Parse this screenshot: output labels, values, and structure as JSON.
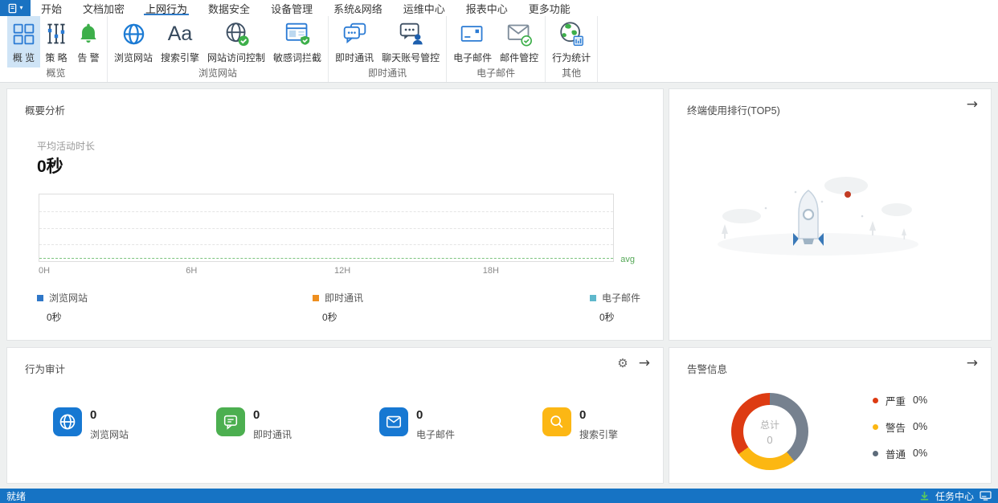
{
  "menu": {
    "items": [
      {
        "label": "开始"
      },
      {
        "label": "文档加密"
      },
      {
        "label": "上网行为",
        "active": true
      },
      {
        "label": "数据安全"
      },
      {
        "label": "设备管理"
      },
      {
        "label": "系统&网络"
      },
      {
        "label": "运维中心"
      },
      {
        "label": "报表中心"
      },
      {
        "label": "更多功能"
      }
    ]
  },
  "icons": {
    "caret_down": "▾",
    "arrow_right": "→",
    "gear": "⚙",
    "aa_glyph": "Aa"
  },
  "ribbon": {
    "groups": [
      {
        "label": "概览",
        "items": [
          {
            "label": "概 览",
            "icon": "overview-grid-icon",
            "selected": true
          },
          {
            "label": "策 略",
            "icon": "policy-sliders-icon"
          },
          {
            "label": "告 警",
            "icon": "alert-bell-icon"
          }
        ]
      },
      {
        "label": "浏览网站",
        "items": [
          {
            "label": "浏览网站",
            "icon": "browse-globe-icon"
          },
          {
            "label": "搜索引擎",
            "icon": "search-engine-aa-icon"
          },
          {
            "label": "网站访问控制",
            "icon": "site-access-control-icon"
          },
          {
            "label": "敏感词拦截",
            "icon": "sensitive-word-block-icon"
          }
        ]
      },
      {
        "label": "即时通讯",
        "items": [
          {
            "label": "即时通讯",
            "icon": "im-chat-icon"
          },
          {
            "label": "聊天账号管控",
            "icon": "chat-account-control-icon"
          }
        ]
      },
      {
        "label": "电子邮件",
        "items": [
          {
            "label": "电子邮件",
            "icon": "email-icon"
          },
          {
            "label": "邮件管控",
            "icon": "mail-control-icon"
          }
        ]
      },
      {
        "label": "其他",
        "items": [
          {
            "label": "行为统计",
            "icon": "behavior-stats-icon"
          }
        ]
      }
    ]
  },
  "summary_card": {
    "title": "概要分析",
    "metric_label": "平均活动时长",
    "metric_value": "0秒",
    "avg_label": "avg",
    "x_ticks": [
      "0H",
      "6H",
      "12H",
      "18H"
    ],
    "legend": [
      {
        "label": "浏览网站",
        "value": "0秒",
        "color": "#2f77c8"
      },
      {
        "label": "即时通讯",
        "value": "0秒",
        "color": "#ee8f20"
      },
      {
        "label": "电子邮件",
        "value": "0秒",
        "color": "#5fb8cc"
      }
    ]
  },
  "top5_card": {
    "title": "终端使用排行(TOP5)"
  },
  "audit_card": {
    "title": "行为审计",
    "stats": [
      {
        "value": "0",
        "label": "浏览网站",
        "icon": "globe-badge-icon",
        "color": "#1778d2"
      },
      {
        "value": "0",
        "label": "即时通讯",
        "icon": "chat-badge-icon",
        "color": "#4caf50"
      },
      {
        "value": "0",
        "label": "电子邮件",
        "icon": "mail-badge-icon",
        "color": "#1778d2"
      },
      {
        "value": "0",
        "label": "搜索引擎",
        "icon": "search-badge-icon",
        "color": "#fcb714"
      }
    ]
  },
  "alert_card": {
    "title": "告警信息",
    "total_label": "总计",
    "total_value": "0",
    "donut": {
      "segments": [
        {
          "color": "#76818f",
          "pct": 39
        },
        {
          "color": "#fcb712",
          "pct": 26
        },
        {
          "color": "#dd3b12",
          "pct": 35
        }
      ]
    },
    "legend": [
      {
        "label": "严重",
        "value": "0%",
        "color": "#dd3b12"
      },
      {
        "label": "警告",
        "value": "0%",
        "color": "#fcb712"
      },
      {
        "label": "普通",
        "value": "0%",
        "color": "#5d6b7a"
      }
    ]
  },
  "status_bar": {
    "ready": "就绪",
    "task_center": "任务中心"
  },
  "chart_data": [
    {
      "type": "area",
      "title": "平均活动时长",
      "x": [
        "0H",
        "6H",
        "12H",
        "18H"
      ],
      "series": [
        {
          "name": "浏览网站",
          "values": [
            0,
            0,
            0,
            0
          ]
        },
        {
          "name": "即时通讯",
          "values": [
            0,
            0,
            0,
            0
          ]
        },
        {
          "name": "电子邮件",
          "values": [
            0,
            0,
            0,
            0
          ]
        }
      ],
      "annotations": [
        "avg"
      ],
      "grid": "dashed-horizontal",
      "legend_position": "bottom"
    },
    {
      "type": "pie",
      "title": "告警信息",
      "labels": [
        "严重",
        "警告",
        "普通"
      ],
      "values": [
        0,
        0,
        0
      ],
      "center_label": "总计",
      "center_value": 0,
      "legend_position": "right"
    }
  ]
}
